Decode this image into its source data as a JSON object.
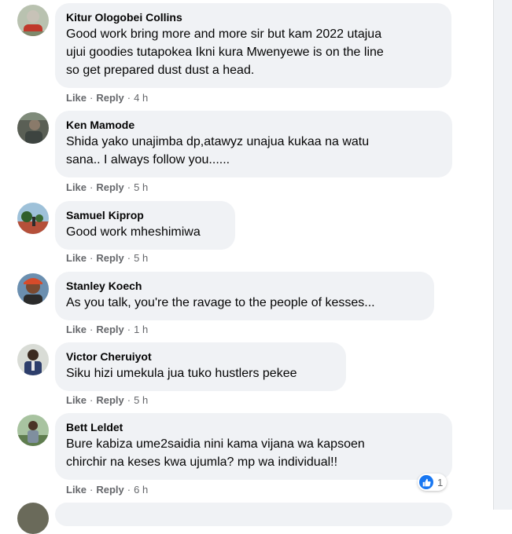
{
  "colors": {
    "bubble_bg": "#f0f2f5",
    "text": "#050505",
    "meta": "#65676b",
    "like_blue": "#1877f2"
  },
  "actions": {
    "like": "Like",
    "reply": "Reply",
    "separator": "·"
  },
  "comments": [
    {
      "author": "Kitur Ologobei Collins",
      "lines": [
        "Good work bring more and more sir but kam 2022 utajua",
        "ujui goodies tutapokea Ikni kura Mwenyewe is on the line",
        "so get prepared dust dust a head."
      ],
      "time": "4 h"
    },
    {
      "author": "Ken Mamode",
      "lines": [
        "Shida yako unajimba dp,atawyz unajua kukaa na watu",
        "sana.. I always follow you......"
      ],
      "time": "5 h"
    },
    {
      "author": "Samuel Kiprop",
      "lines": [
        "Good work mheshimiwa"
      ],
      "time": "5 h"
    },
    {
      "author": "Stanley Koech",
      "lines": [
        "As you talk, you're the ravage to the people of kesses..."
      ],
      "time": "1 h"
    },
    {
      "author": "Victor Cheruiyot",
      "lines": [
        "Siku hizi umekula jua tuko hustlers pekee"
      ],
      "time": "5 h"
    },
    {
      "author": "Bett Leldet",
      "lines": [
        "Bure kabiza ume2saidia nini kama vijana wa kapsoen",
        "chirchir na keses kwa ujumla? mp wa individual!!"
      ],
      "time": "6 h",
      "reaction": {
        "icon": "like-reaction-icon",
        "count": "1"
      }
    }
  ]
}
